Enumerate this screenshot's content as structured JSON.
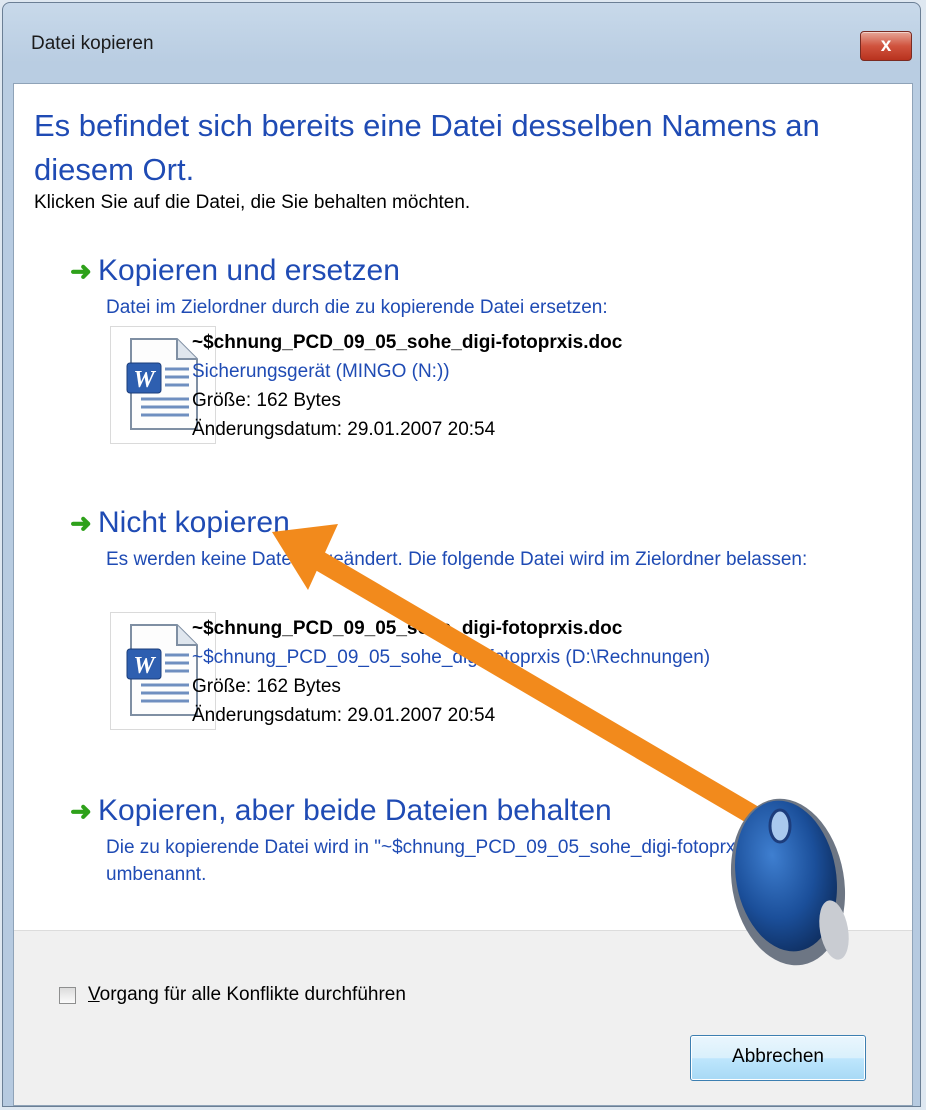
{
  "window": {
    "title": "Datei kopieren",
    "close_label": "x"
  },
  "heading": "Es befindet sich bereits eine Datei desselben Namens an diesem Ort.",
  "instruction": "Klicken Sie auf die Datei, die Sie behalten möchten.",
  "options": [
    {
      "title": "Kopieren und ersetzen",
      "description": "Datei im Zielordner durch die zu kopierende Datei ersetzen:",
      "file": {
        "name": "~$chnung_PCD_09_05_sohe_digi-fotoprxis.doc",
        "location": "Sicherungsgerät (MINGO (N:))",
        "size": "Größe: 162 Bytes",
        "modified": "Änderungsdatum: 29.01.2007 20:54",
        "icon": "word-document-icon"
      }
    },
    {
      "title": "Nicht kopieren",
      "description": "Es werden keine Dateien geändert. Die folgende Datei wird im Zielordner belassen:",
      "file": {
        "name": "~$chnung_PCD_09_05_sohe_digi-fotoprxis.doc",
        "location": "~$chnung_PCD_09_05_sohe_digi-fotoprxis (D:\\Rechnungen)",
        "size": "Größe: 162 Bytes",
        "modified": "Änderungsdatum: 29.01.2007 20:54",
        "icon": "word-document-icon"
      }
    },
    {
      "title": "Kopieren, aber beide Dateien behalten",
      "description": "Die zu kopierende Datei wird in \"~$chnung_PCD_09_05_sohe_digi-fotoprxis (2).doc\" umbenannt."
    }
  ],
  "footer": {
    "checkbox_checked": false,
    "checkbox_label_accel": "V",
    "checkbox_label_rest": "organg für alle Konflikte durchführen",
    "cancel_label": "Abbrechen"
  },
  "colors": {
    "link_blue": "#1f4bb4",
    "arrow_green": "#2ea11a",
    "annotation_orange": "#f28a1c"
  },
  "icons": [
    "close-icon",
    "green-arrow-icon",
    "word-document-icon",
    "mouse-icon"
  ]
}
